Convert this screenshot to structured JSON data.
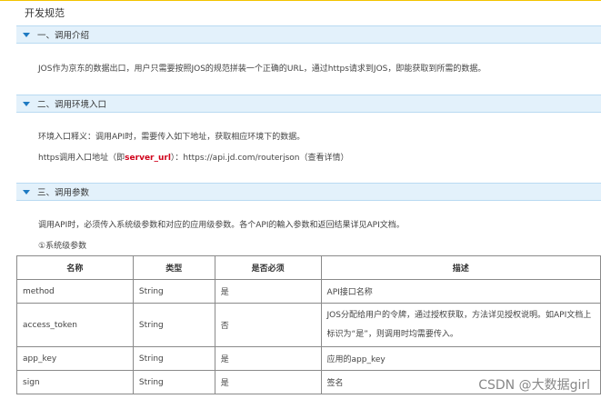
{
  "page_title": "开发规范",
  "sections": [
    {
      "title": "一、调用介绍"
    },
    {
      "title": "二、调用环境入口"
    },
    {
      "title": "三、调用参数"
    }
  ],
  "intro_text": "JOS作为京东的数据出口，用户只需要按照JOS的规范拼装一个正确的URL，通过https请求到JOS，即能获取到所需的数据。",
  "env": {
    "definition": "环境入口释义：调用API时，需要传入如下地址，获取相应环境下的数据。",
    "url_prefix": "https调用入口地址（即",
    "url_key": "server_url",
    "url_suffix": "）：https://api.jd.com/routerjson（查看详情）"
  },
  "params": {
    "intro": "调用API时，必须传入系统级参数和对应的应用级参数。各个API的輸入参数和返回结果详见API文档。",
    "subheading": "①系统级参数",
    "headers": [
      "名称",
      "类型",
      "是否必须",
      "描述"
    ],
    "rows": [
      {
        "name": "method",
        "type": "String",
        "required": "是",
        "desc": "API接口名称"
      },
      {
        "name": "access_token",
        "type": "String",
        "required": "否",
        "desc": "JOS分配给用户的令牌，通过授权获取，方法详见授权说明。如API文档上标识为“是”，则调用时均需要传入。"
      },
      {
        "name": "app_key",
        "type": "String",
        "required": "是",
        "desc": "应用的app_key"
      },
      {
        "name": "sign",
        "type": "String",
        "required": "是",
        "desc": "签名"
      }
    ]
  },
  "watermark": "CSDN @大数据girl"
}
